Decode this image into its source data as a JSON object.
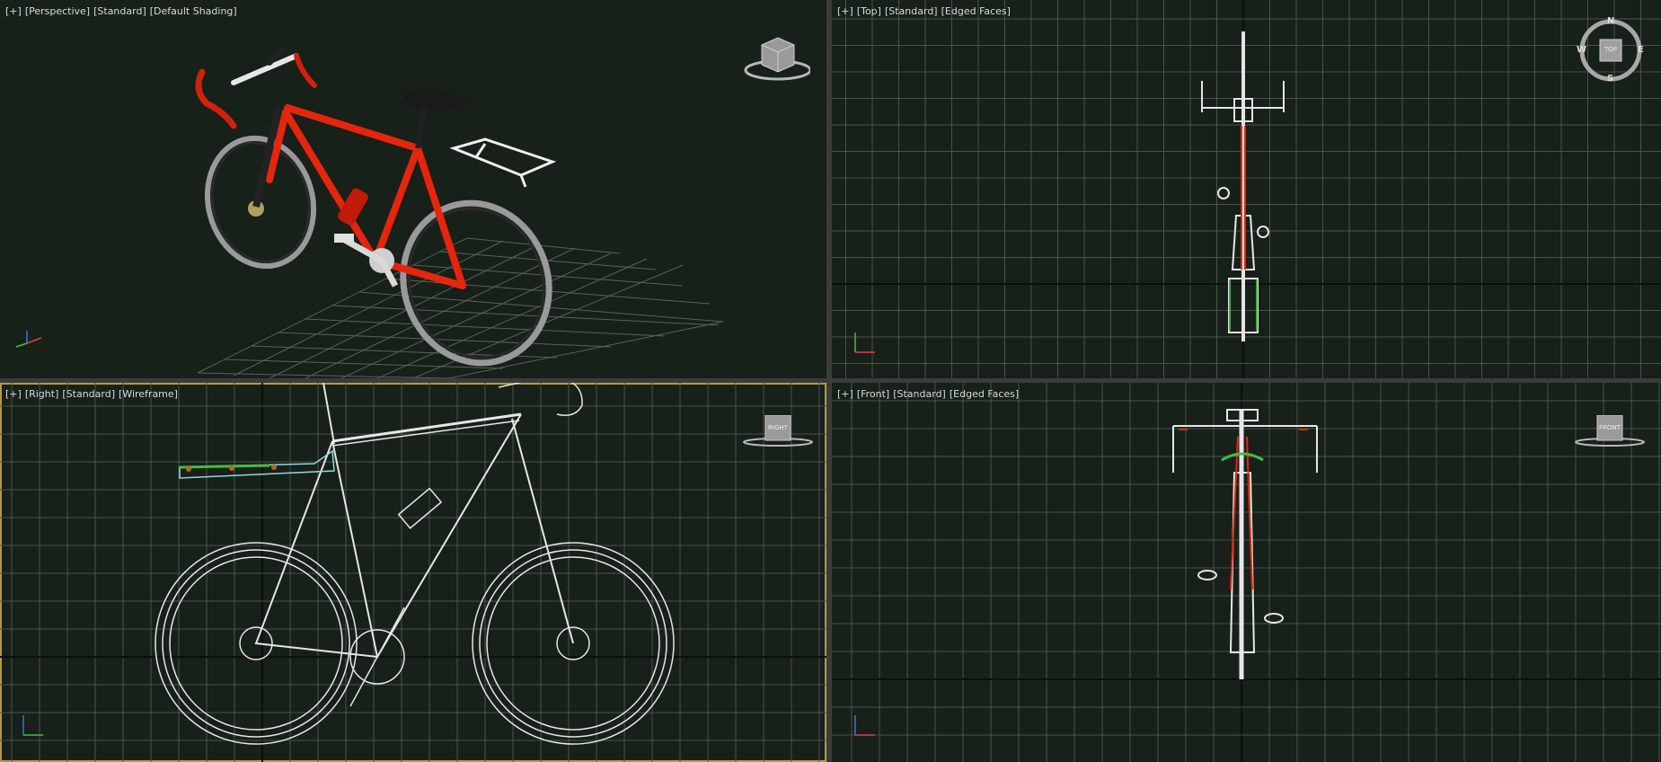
{
  "viewports": {
    "perspective": {
      "plus": "[+]",
      "view": "[Perspective]",
      "mode": "[Standard]",
      "shading": "[Default Shading]"
    },
    "top": {
      "plus": "[+]",
      "view": "[Top]",
      "mode": "[Standard]",
      "shading": "[Edged Faces]",
      "compass": {
        "n": "N",
        "s": "S",
        "w": "W",
        "e": "E",
        "cube": "TOP"
      }
    },
    "right": {
      "plus": "[+]",
      "view": "[Right]",
      "mode": "[Standard]",
      "shading": "[Wireframe]",
      "cube": "RIGHT"
    },
    "front": {
      "plus": "[+]",
      "view": "[Front]",
      "mode": "[Standard]",
      "shading": "[Edged Faces]",
      "cube": "FRONT"
    }
  },
  "axis_labels": {
    "x": "x",
    "y": "y",
    "z": "z"
  },
  "colors": {
    "viewport_bg": "#18201a",
    "grid": "#4a524b",
    "grid_axis": "#0c0f0c",
    "active_border": "#b69a3e",
    "bike_red": "#e5260d",
    "wire": "#e6e6e6"
  }
}
